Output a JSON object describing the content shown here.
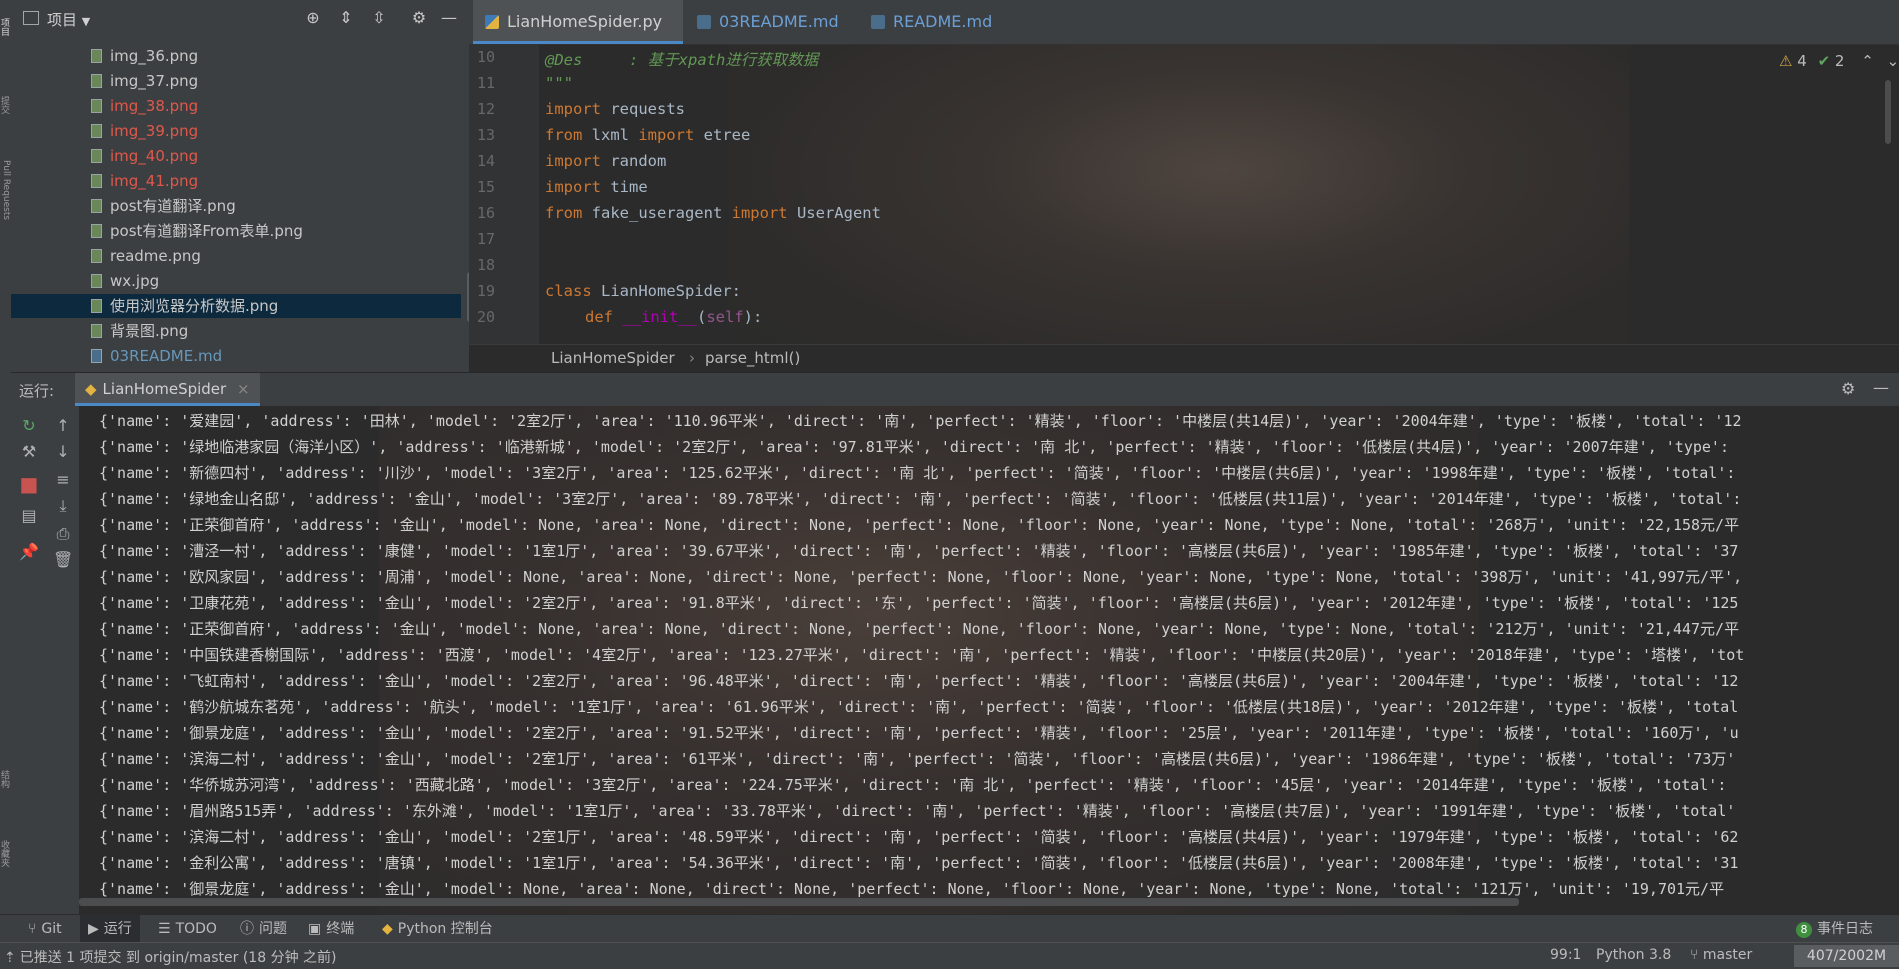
{
  "left_strip": {
    "top_label": "项目",
    "mid_label": "提交",
    "pr_label": "Pull Requests",
    "bottom_label1": "结构",
    "bottom_label2": "收藏夹"
  },
  "project": {
    "title": "项目",
    "files": [
      {
        "name": "img_36.png",
        "status": "normal"
      },
      {
        "name": "img_37.png",
        "status": "normal"
      },
      {
        "name": "img_38.png",
        "status": "red"
      },
      {
        "name": "img_39.png",
        "status": "red"
      },
      {
        "name": "img_40.png",
        "status": "red"
      },
      {
        "name": "img_41.png",
        "status": "red"
      },
      {
        "name": "post有道翻译.png",
        "status": "normal"
      },
      {
        "name": "post有道翻译From表单.png",
        "status": "normal"
      },
      {
        "name": "readme.png",
        "status": "normal"
      },
      {
        "name": "wx.jpg",
        "status": "normal"
      },
      {
        "name": "使用浏览器分析数据.png",
        "status": "selected"
      },
      {
        "name": "背景图.png",
        "status": "normal"
      },
      {
        "name": "03README.md",
        "status": "md"
      }
    ]
  },
  "editor": {
    "tabs": [
      {
        "label": "LianHomeSpider.py",
        "kind": "py"
      },
      {
        "label": "03README.md",
        "kind": "md"
      },
      {
        "label": "README.md",
        "kind": "md"
      }
    ],
    "line_numbers": [
      "10",
      "11",
      "12",
      "13",
      "14",
      "15",
      "16",
      "17",
      "18",
      "19",
      "20"
    ],
    "code": {
      "l10_tag": "@Des",
      "l10_rest": "     : 基于xpath进行获取数据",
      "l11": "\"\"\"",
      "l12_kw": "import",
      "l12_rest": " requests",
      "l13_kw1": "from",
      "l13_mid": " lxml ",
      "l13_kw2": "import",
      "l13_rest": " etree",
      "l14_kw": "import",
      "l14_rest": " random",
      "l15_kw": "import",
      "l15_rest": " time",
      "l16_kw1": "from",
      "l16_mid": " fake_useragent ",
      "l16_kw2": "import",
      "l16_rest": " UserAgent",
      "l19_kw": "class",
      "l19_rest": " LianHomeSpider:",
      "l20_kw": "def",
      "l20_fn": "__init__",
      "l20_open": "(",
      "l20_self": "self",
      "l20_close": "):"
    },
    "inspection": {
      "warnings": "4",
      "ok": "2"
    },
    "breadcrumb": [
      "LianHomeSpider",
      "parse_html()"
    ]
  },
  "run": {
    "label": "运行:",
    "tab": "LianHomeSpider",
    "output": [
      "{'name': '爱建园', 'address': '田林', 'model': '2室2厅', 'area': '110.96平米', 'direct': '南', 'perfect': '精装', 'floor': '中楼层(共14层)', 'year': '2004年建', 'type': '板楼', 'total': '12",
      "{'name': '绿地临港家园（海洋小区）', 'address': '临港新城', 'model': '2室2厅', 'area': '97.81平米', 'direct': '南 北', 'perfect': '精装', 'floor': '低楼层(共4层)', 'year': '2007年建', 'type':",
      "{'name': '新德四村', 'address': '川沙', 'model': '3室2厅', 'area': '125.62平米', 'direct': '南 北', 'perfect': '简装', 'floor': '中楼层(共6层)', 'year': '1998年建', 'type': '板楼', 'total':",
      "{'name': '绿地金山名邸', 'address': '金山', 'model': '3室2厅', 'area': '89.78平米', 'direct': '南', 'perfect': '简装', 'floor': '低楼层(共11层)', 'year': '2014年建', 'type': '板楼', 'total':",
      "{'name': '正荣御首府', 'address': '金山', 'model': None, 'area': None, 'direct': None, 'perfect': None, 'floor': None, 'year': None, 'type': None, 'total': '268万', 'unit': '22,158元/平",
      "{'name': '漕泾一村', 'address': '康健', 'model': '1室1厅', 'area': '39.67平米', 'direct': '南', 'perfect': '精装', 'floor': '高楼层(共6层)', 'year': '1985年建', 'type': '板楼', 'total': '37",
      "{'name': '欧风家园', 'address': '周浦', 'model': None, 'area': None, 'direct': None, 'perfect': None, 'floor': None, 'year': None, 'type': None, 'total': '398万', 'unit': '41,997元/平',",
      "{'name': '卫康花苑', 'address': '金山', 'model': '2室2厅', 'area': '91.8平米', 'direct': '东', 'perfect': '简装', 'floor': '高楼层(共6层)', 'year': '2012年建', 'type': '板楼', 'total': '125",
      "{'name': '正荣御首府', 'address': '金山', 'model': None, 'area': None, 'direct': None, 'perfect': None, 'floor': None, 'year': None, 'type': None, 'total': '212万', 'unit': '21,447元/平",
      "{'name': '中国铁建香榭国际', 'address': '西渡', 'model': '4室2厅', 'area': '123.27平米', 'direct': '南', 'perfect': '精装', 'floor': '中楼层(共20层)', 'year': '2018年建', 'type': '塔楼', 'tot",
      "{'name': '飞虹南村', 'address': '金山', 'model': '2室2厅', 'area': '96.48平米', 'direct': '南', 'perfect': '精装', 'floor': '高楼层(共6层)', 'year': '2004年建', 'type': '板楼', 'total': '12",
      "{'name': '鹤沙航城东茗苑', 'address': '航头', 'model': '1室1厅', 'area': '61.96平米', 'direct': '南', 'perfect': '简装', 'floor': '低楼层(共18层)', 'year': '2012年建', 'type': '板楼', 'total",
      "{'name': '御景龙庭', 'address': '金山', 'model': '2室2厅', 'area': '91.52平米', 'direct': '南', 'perfect': '精装', 'floor': '25层', 'year': '2011年建', 'type': '板楼', 'total': '160万', 'u",
      "{'name': '滨海二村', 'address': '金山', 'model': '2室1厅', 'area': '61平米', 'direct': '南', 'perfect': '简装', 'floor': '高楼层(共6层)', 'year': '1986年建', 'type': '板楼', 'total': '73万'",
      "{'name': '华侨城苏河湾', 'address': '西藏北路', 'model': '3室2厅', 'area': '224.75平米', 'direct': '南 北', 'perfect': '精装', 'floor': '45层', 'year': '2014年建', 'type': '板楼', 'total':",
      "{'name': '眉州路515弄', 'address': '东外滩', 'model': '1室1厅', 'area': '33.78平米', 'direct': '南', 'perfect': '精装', 'floor': '高楼层(共7层)', 'year': '1991年建', 'type': '板楼', 'total'",
      "{'name': '滨海二村', 'address': '金山', 'model': '2室1厅', 'area': '48.59平米', 'direct': '南', 'perfect': '简装', 'floor': '高楼层(共4层)', 'year': '1979年建', 'type': '板楼', 'total': '62",
      "{'name': '金利公寓', 'address': '唐镇', 'model': '1室1厅', 'area': '54.36平米', 'direct': '南', 'perfect': '简装', 'floor': '低楼层(共6层)', 'year': '2008年建', 'type': '板楼', 'total': '31",
      "{'name': '御景龙庭', 'address': '金山', 'model': None, 'area': None, 'direct': None, 'perfect': None, 'floor': None, 'year': None, 'type': None, 'total': '121万', 'unit': '19,701元/平"
    ]
  },
  "tool_tabs": [
    "Git",
    "运行",
    "TODO",
    "问题",
    "终端",
    "Python 控制台"
  ],
  "event_log": {
    "count": "8",
    "label": "事件日志"
  },
  "status": {
    "message": "已推送 1 项提交 到 origin/master (18 分钟 之前)",
    "position": "99:1",
    "interpreter": "Python 3.8",
    "branch": "master",
    "memory": "407/2002M"
  }
}
